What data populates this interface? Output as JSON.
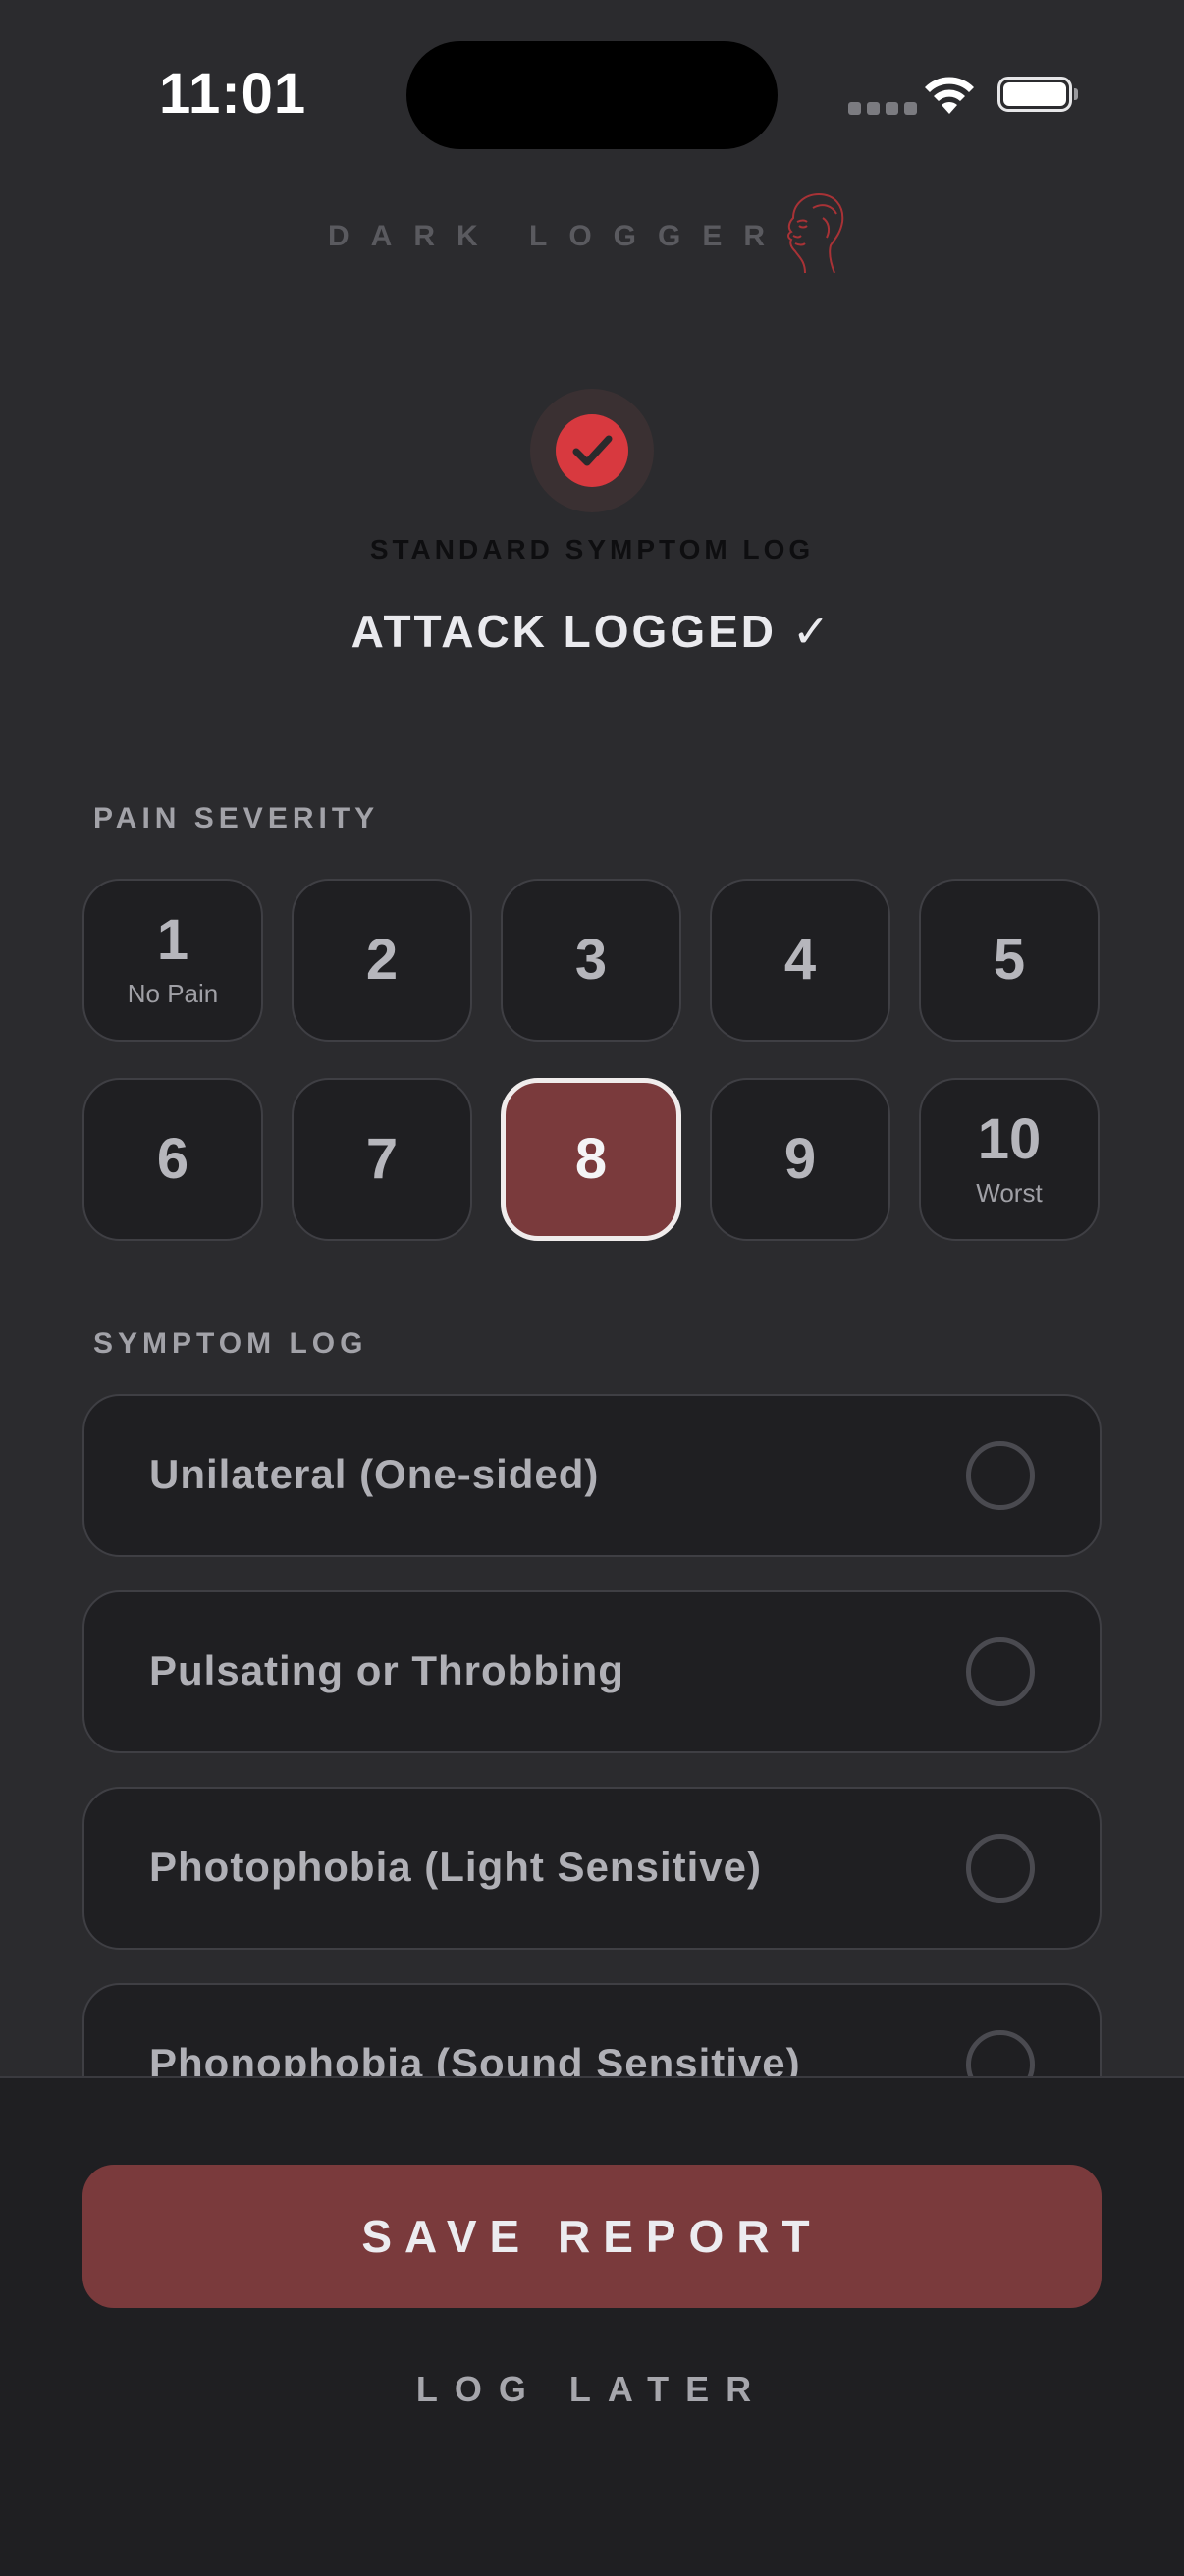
{
  "status_bar": {
    "time": "11:01"
  },
  "brand": {
    "name": "DARK LOGGER",
    "logo_icon": "head-profile-icon",
    "accent_color": "#d8393f"
  },
  "confirmation": {
    "icon": "check-circle-icon",
    "subtitle": "STANDARD SYMPTOM LOG",
    "title": "ATTACK LOGGED ✓"
  },
  "pain_severity": {
    "label": "PAIN SEVERITY",
    "selected": "8",
    "options": [
      {
        "value": "1",
        "caption": "No Pain"
      },
      {
        "value": "2",
        "caption": ""
      },
      {
        "value": "3",
        "caption": ""
      },
      {
        "value": "4",
        "caption": ""
      },
      {
        "value": "5",
        "caption": ""
      },
      {
        "value": "6",
        "caption": ""
      },
      {
        "value": "7",
        "caption": ""
      },
      {
        "value": "8",
        "caption": ""
      },
      {
        "value": "9",
        "caption": ""
      },
      {
        "value": "10",
        "caption": "Worst"
      }
    ]
  },
  "symptom_log": {
    "label": "SYMPTOM LOG",
    "items": [
      {
        "label": "Unilateral (One-sided)",
        "checked": false
      },
      {
        "label": "Pulsating or Throbbing",
        "checked": false
      },
      {
        "label": "Photophobia (Light Sensitive)",
        "checked": false
      },
      {
        "label": "Phonophobia (Sound Sensitive)",
        "checked": false
      }
    ]
  },
  "actions": {
    "save_label": "SAVE REPORT",
    "later_label": "LOG LATER",
    "save_color": "#7a3a3c"
  }
}
